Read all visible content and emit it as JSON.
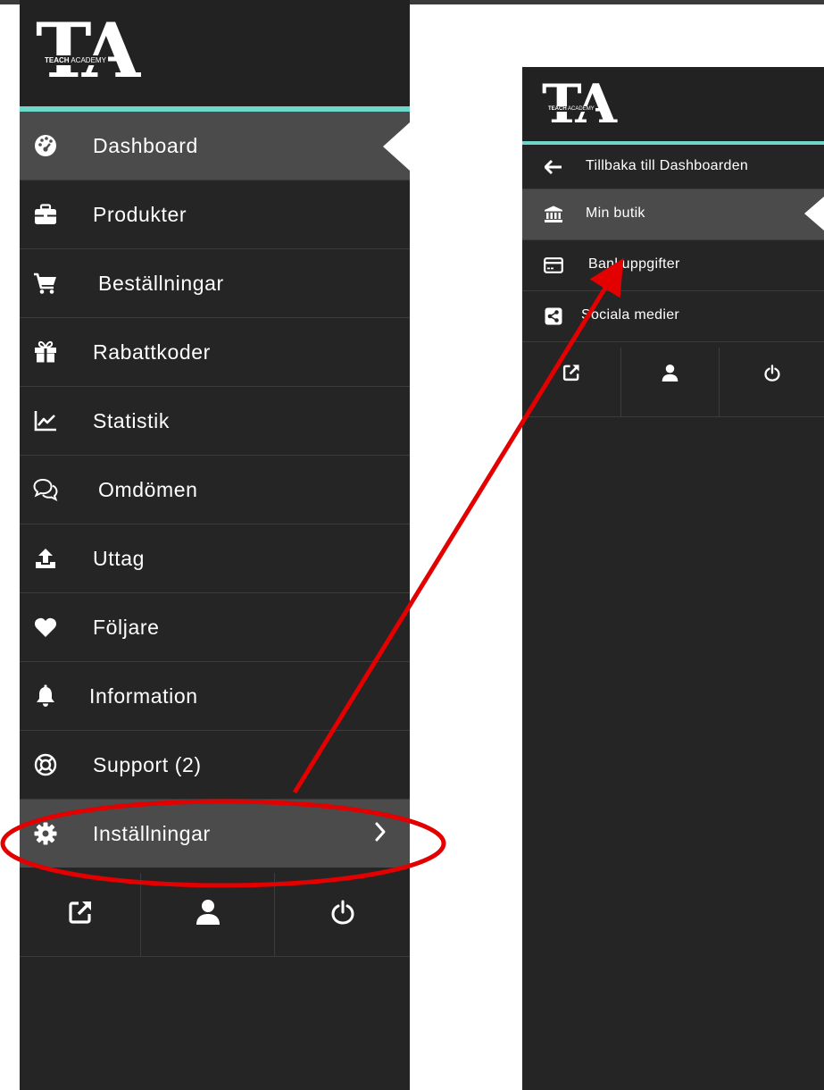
{
  "brand": {
    "logo_letters": "TA",
    "logo_word1": "TEACH",
    "logo_word2": "ACADEMY"
  },
  "main_menu": {
    "items": [
      {
        "label": "Dashboard",
        "icon": "dashboard-gauge-icon",
        "active": true
      },
      {
        "label": "Produkter",
        "icon": "briefcase-icon"
      },
      {
        "label": "Beställningar",
        "icon": "shopping-cart-icon"
      },
      {
        "label": "Rabattkoder",
        "icon": "gift-icon"
      },
      {
        "label": "Statistik",
        "icon": "line-chart-icon"
      },
      {
        "label": "Omdömen",
        "icon": "chat-bubbles-icon"
      },
      {
        "label": "Uttag",
        "icon": "upload-tray-icon"
      },
      {
        "label": "Följare",
        "icon": "heart-icon"
      },
      {
        "label": "Information",
        "icon": "bell-icon"
      },
      {
        "label": "Support (2)",
        "icon": "lifebuoy-icon"
      },
      {
        "label": "Inställningar",
        "icon": "gear-icon",
        "highlighted": true,
        "has_submenu": true
      }
    ],
    "bottom_actions": [
      "external-link-icon",
      "user-icon",
      "power-icon"
    ]
  },
  "settings_menu": {
    "items": [
      {
        "label": "Tillbaka till Dashboarden",
        "icon": "arrow-left-icon"
      },
      {
        "label": "Min butik",
        "icon": "bank-icon",
        "active": true
      },
      {
        "label": "Bankuppgifter",
        "icon": "credit-card-icon"
      },
      {
        "label": "Sociala medier",
        "icon": "share-square-icon"
      }
    ],
    "bottom_actions": [
      "external-link-icon",
      "user-icon",
      "power-icon"
    ]
  },
  "colors": {
    "panel_bg": "#252525",
    "active_bg": "#4b4b4b",
    "accent": "#6dd8c9",
    "annotation": "#e20000"
  }
}
